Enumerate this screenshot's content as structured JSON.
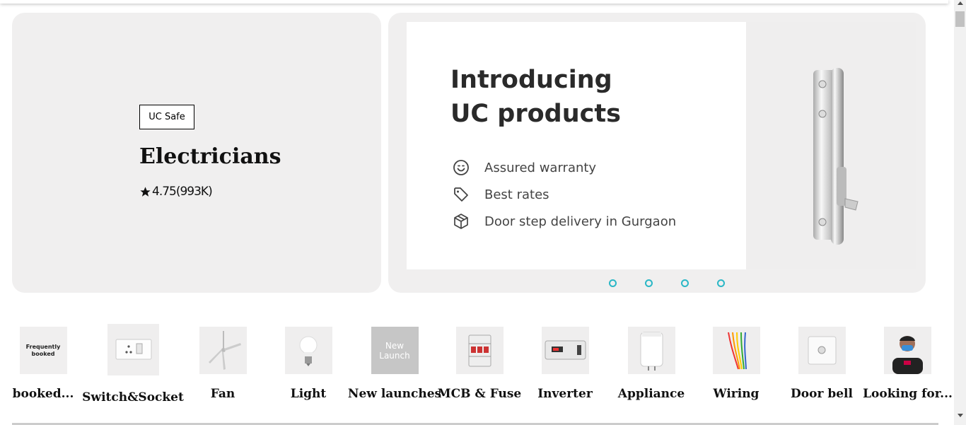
{
  "service": {
    "badge": "UC Safe",
    "title": "Electricians",
    "rating": "4.75(993K)"
  },
  "banner": {
    "heading_line1": "Introducing",
    "heading_line2": "UC products",
    "features": [
      {
        "icon": "smiley-icon",
        "text": "Assured warranty"
      },
      {
        "icon": "tag-icon",
        "text": "Best rates"
      },
      {
        "icon": "box-icon",
        "text": "Door step delivery in Gurgaon"
      }
    ],
    "slide_count": 4
  },
  "categories": [
    {
      "label": "booked...",
      "thumb_text": "Frequently booked",
      "icon": "frequently-booked-icon"
    },
    {
      "label": "Switch&Socket",
      "icon": "switch-socket-icon"
    },
    {
      "label": "Fan",
      "icon": "fan-icon"
    },
    {
      "label": "Light",
      "icon": "bulb-icon"
    },
    {
      "label": "New launches",
      "thumb_text": "New Launch",
      "icon": "new-launch-icon"
    },
    {
      "label": "MCB & Fuse",
      "icon": "mcb-icon"
    },
    {
      "label": "Inverter",
      "icon": "inverter-icon"
    },
    {
      "label": "Appliance",
      "icon": "geyser-icon"
    },
    {
      "label": "Wiring",
      "icon": "wires-icon"
    },
    {
      "label": "Door bell",
      "icon": "doorbell-icon"
    },
    {
      "label": "Looking for...",
      "icon": "technician-icon"
    }
  ],
  "colors": {
    "card_bg": "#f0efef",
    "dot_accent": "#2ab7c6"
  }
}
